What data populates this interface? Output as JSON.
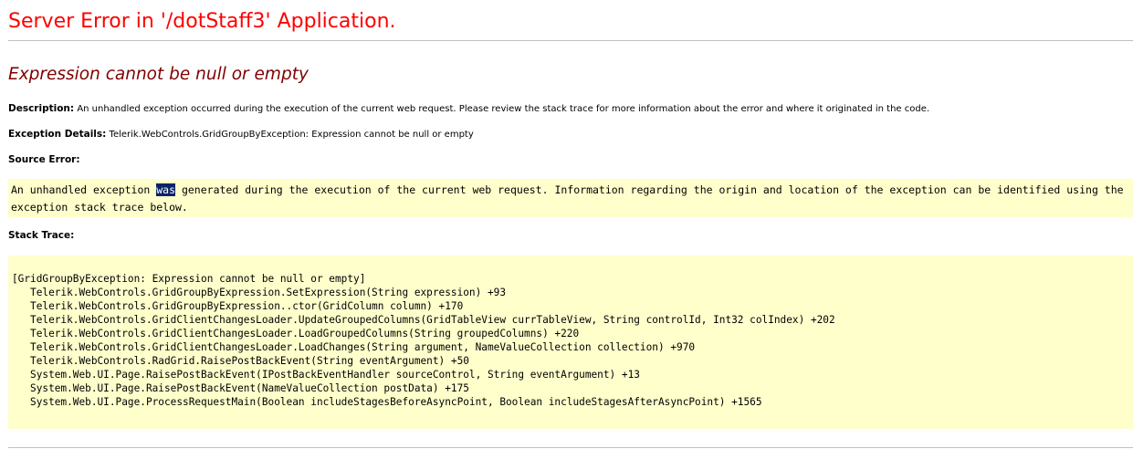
{
  "page": {
    "server_title": "Server Error in '/dotStaff3' Application.",
    "error_heading": "Expression cannot be null or empty",
    "description_label": "Description:",
    "description_text": "An unhandled exception occurred during the execution of the current web request. Please review the stack trace for more information about the error and where it originated in the code.",
    "exception_label": "Exception Details:",
    "exception_text": "Telerik.WebControls.GridGroupByException: Expression cannot be null or empty",
    "source_error_label": "Source Error:",
    "source_error": {
      "before": "An unhandled exception ",
      "selected": "was",
      "after": " generated during the execution of the current web request. Information regarding the origin and location of the exception can be identified using the exception stack trace below."
    },
    "stack_trace_label": "Stack Trace:",
    "stack_trace": [
      "[GridGroupByException: Expression cannot be null or empty]",
      "   Telerik.WebControls.GridGroupByExpression.SetExpression(String expression) +93",
      "   Telerik.WebControls.GridGroupByExpression..ctor(GridColumn column) +170",
      "   Telerik.WebControls.GridClientChangesLoader.UpdateGroupedColumns(GridTableView currTableView, String controlId, Int32 colIndex) +202",
      "   Telerik.WebControls.GridClientChangesLoader.LoadGroupedColumns(String groupedColumns) +220",
      "   Telerik.WebControls.GridClientChangesLoader.LoadChanges(String argument, NameValueCollection collection) +970",
      "   Telerik.WebControls.RadGrid.RaisePostBackEvent(String eventArgument) +50",
      "   System.Web.UI.Page.RaisePostBackEvent(IPostBackEventHandler sourceControl, String eventArgument) +13",
      "   System.Web.UI.Page.RaisePostBackEvent(NameValueCollection postData) +175",
      "   System.Web.UI.Page.ProcessRequestMain(Boolean includeStagesBeforeAsyncPoint, Boolean includeStagesAfterAsyncPoint) +1565"
    ]
  },
  "colors": {
    "title": "#ff0000",
    "heading": "#800000",
    "code_background": "#ffffcc",
    "selection_background": "#0a246a",
    "selection_text": "#ffffff"
  }
}
